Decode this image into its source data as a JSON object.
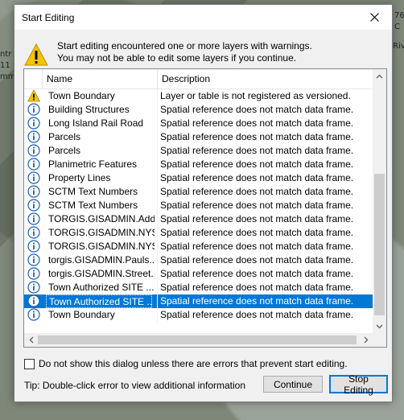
{
  "background_map": {
    "labels_left": [
      "ntr",
      "11",
      "mm"
    ],
    "labels_right": [
      "76",
      "C",
      "Riv"
    ]
  },
  "dialog": {
    "title": "Start Editing",
    "message_line1": "Start editing encountered one or more layers with warnings.",
    "message_line2": "You may not be able to edit some layers if you continue.",
    "columns": {
      "name": "Name",
      "description": "Description"
    },
    "rows": [
      {
        "icon": "warning-icon",
        "name": "Town Boundary",
        "description": "Layer or table is not registered as versioned."
      },
      {
        "icon": "info-icon",
        "name": "Building Structures",
        "description": "Spatial reference does not match data frame."
      },
      {
        "icon": "info-icon",
        "name": "Long Island Rail Road",
        "description": "Spatial reference does not match data frame."
      },
      {
        "icon": "info-icon",
        "name": "Parcels",
        "description": "Spatial reference does not match data frame."
      },
      {
        "icon": "info-icon",
        "name": "Parcels",
        "description": "Spatial reference does not match data frame."
      },
      {
        "icon": "info-icon",
        "name": "Planimetric Features",
        "description": "Spatial reference does not match data frame."
      },
      {
        "icon": "info-icon",
        "name": "Property Lines",
        "description": "Spatial reference does not match data frame."
      },
      {
        "icon": "info-icon",
        "name": "SCTM Text Numbers",
        "description": "Spatial reference does not match data frame."
      },
      {
        "icon": "info-icon",
        "name": "SCTM Text Numbers",
        "description": "Spatial reference does not match data frame."
      },
      {
        "icon": "info-icon",
        "name": "TORGIS.GISADMIN.Add...",
        "description": "Spatial reference does not match data frame."
      },
      {
        "icon": "info-icon",
        "name": "TORGIS.GISADMIN.NYS...",
        "description": "Spatial reference does not match data frame."
      },
      {
        "icon": "info-icon",
        "name": "TORGIS.GISADMIN.NYS...",
        "description": "Spatial reference does not match data frame."
      },
      {
        "icon": "info-icon",
        "name": "torgis.GISADMIN.Pauls...",
        "description": "Spatial reference does not match data frame."
      },
      {
        "icon": "info-icon",
        "name": "torgis.GISADMIN.Street...",
        "description": "Spatial reference does not match data frame."
      },
      {
        "icon": "info-icon",
        "name": "Town Authorized SITE ...",
        "description": "Spatial reference does not match data frame."
      },
      {
        "icon": "info-icon",
        "name": "Town Authorized SITE ...",
        "description": "Spatial reference does not match data frame.",
        "selected": true
      },
      {
        "icon": "info-icon",
        "name": "Town Boundary",
        "description": "Spatial reference does not match data frame."
      }
    ],
    "checkbox_label": "Do not show this dialog unless there are errors that prevent start editing.",
    "checkbox_checked": false,
    "tip": "Tip: Double-click error to view additional information",
    "continue_label": "Continue",
    "stop_label": "Stop Editing"
  },
  "colors": {
    "selection": "#0078d7",
    "warning": "#f5c400",
    "info": "#1a5fb4"
  }
}
